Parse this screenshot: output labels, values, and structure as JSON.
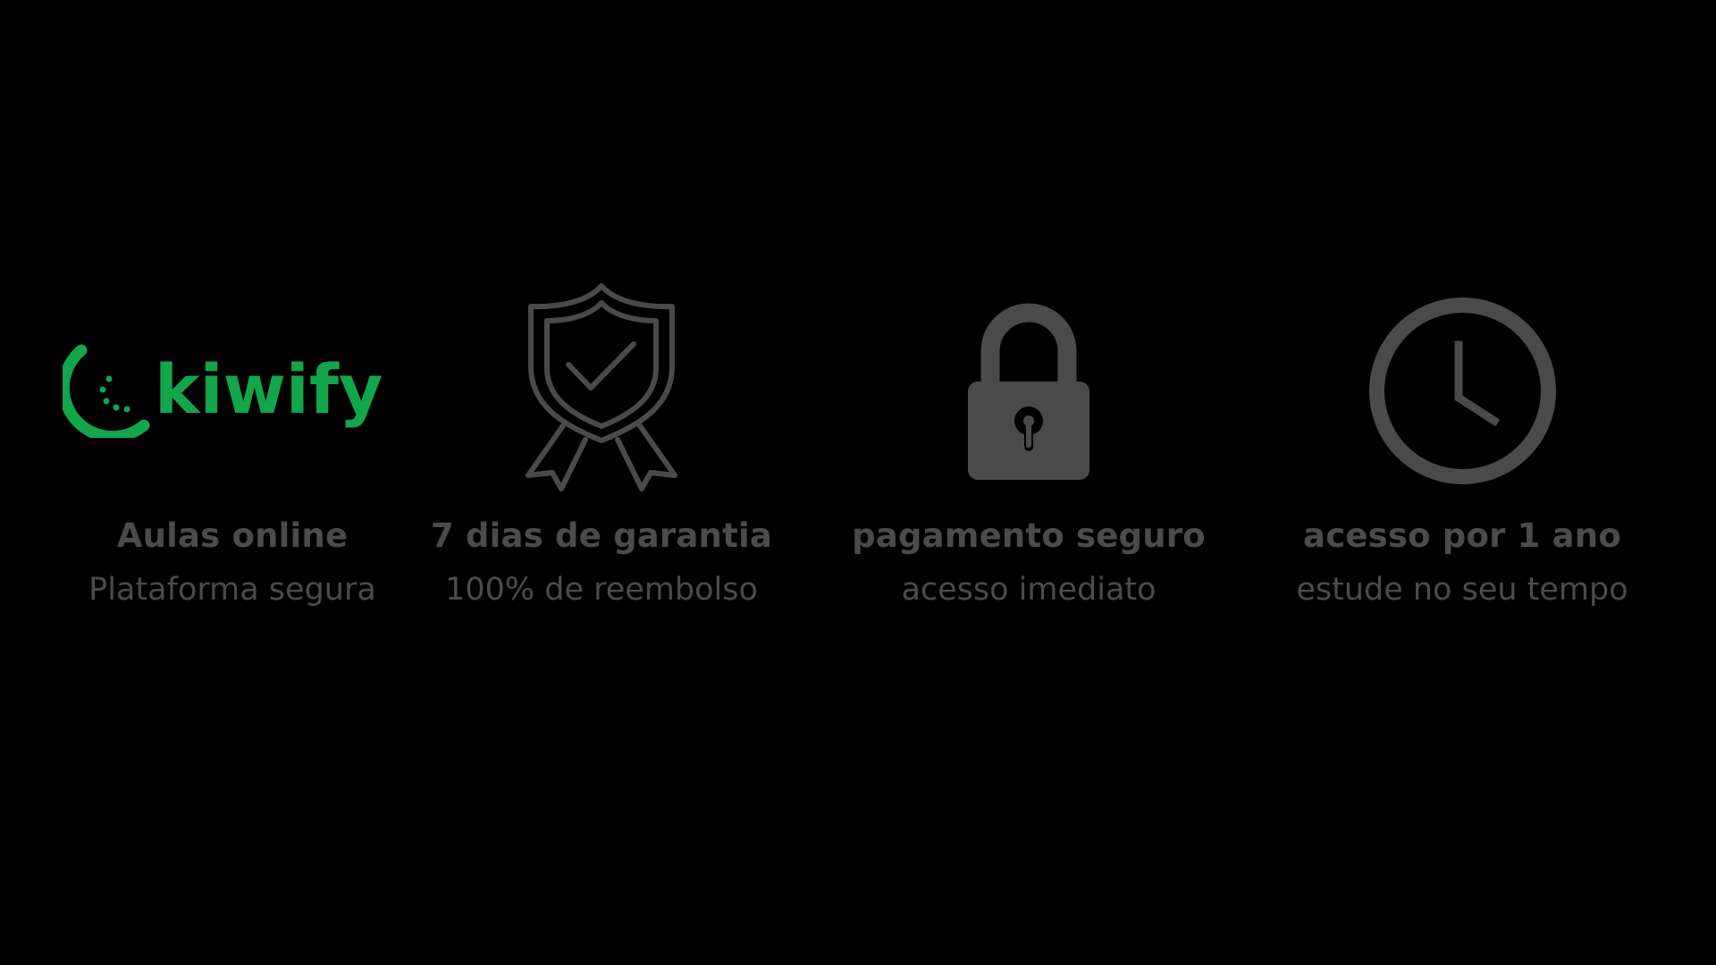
{
  "colors": {
    "background": "#000000",
    "brand_green": "#12a54c",
    "icon_gray": "#4a4a4a",
    "text_gray": "#4b4b4b"
  },
  "features": [
    {
      "icon": "kiwify-logo",
      "logo_text": "kiwify",
      "title": "Aulas online",
      "subtitle": "Plataforma segura"
    },
    {
      "icon": "award-shield-check-icon",
      "title": "7 dias de garantia",
      "subtitle": "100% de reembolso"
    },
    {
      "icon": "padlock-icon",
      "title": "pagamento seguro",
      "subtitle": "acesso imediato"
    },
    {
      "icon": "clock-icon",
      "title": "acesso por 1 ano",
      "subtitle": "estude no seu tempo"
    }
  ]
}
